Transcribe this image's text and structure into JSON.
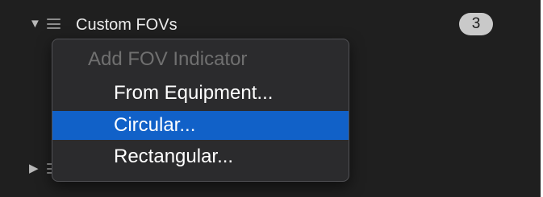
{
  "group": {
    "title": "Custom FOVs",
    "count": "3",
    "expanded_glyph": "▼",
    "collapsed_glyph": "▶"
  },
  "menu": {
    "header": "Add FOV Indicator",
    "items": [
      {
        "label": "From Equipment...",
        "selected": false
      },
      {
        "label": "Circular...",
        "selected": true
      },
      {
        "label": "Rectangular...",
        "selected": false
      }
    ]
  },
  "colors": {
    "background": "#1f1f1f",
    "menu_background": "#2b2b2d",
    "selection": "#1161c8",
    "badge": "#c9c9c9"
  }
}
